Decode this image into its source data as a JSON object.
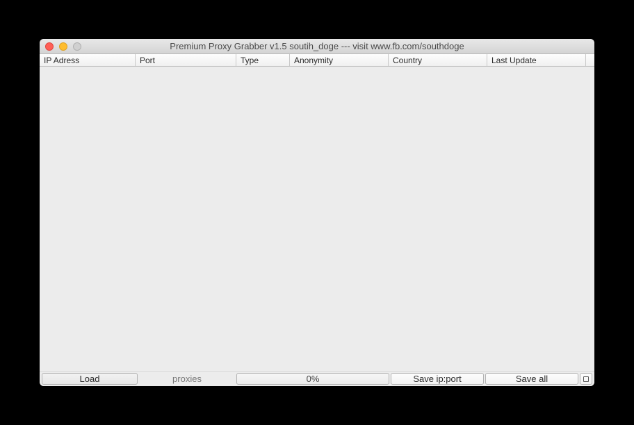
{
  "window": {
    "title": "Premium Proxy Grabber v1.5 soutih_doge --- visit www.fb.com/southdoge"
  },
  "columns": {
    "ip": "IP Adress",
    "port": "Port",
    "type": "Type",
    "anonymity": "Anonymity",
    "country": "Country",
    "lastUpdate": "Last Update"
  },
  "bottom": {
    "load": "Load",
    "proxies": "proxies",
    "progress": "0%",
    "saveIpPort": "Save ip:port",
    "saveAll": "Save all"
  },
  "rows": []
}
